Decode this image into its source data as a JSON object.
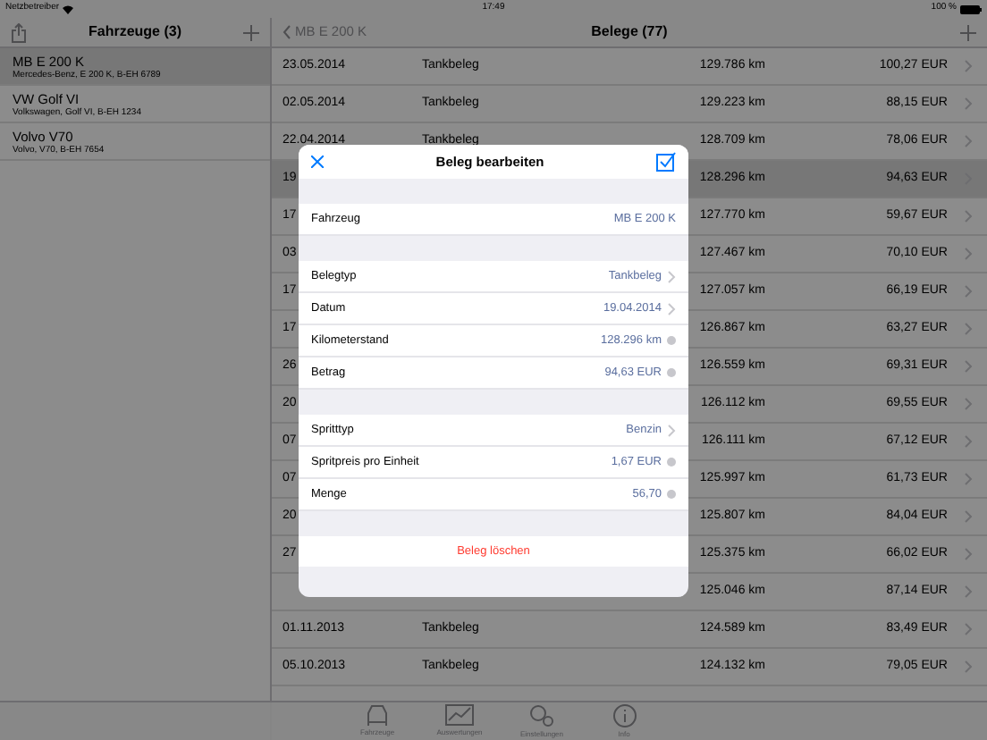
{
  "status_bar": {
    "carrier": "Netzbetreiber",
    "time": "17:49",
    "battery": "100 %"
  },
  "sidebar": {
    "title": "Fahrzeuge (3)",
    "items": [
      {
        "name": "MB E 200 K",
        "detail": "Mercedes-Benz, E 200 K, B-EH 6789",
        "selected": true
      },
      {
        "name": "VW Golf VI",
        "detail": "Volkswagen, Golf VI, B-EH 1234",
        "selected": false
      },
      {
        "name": "Volvo V70",
        "detail": "Volvo, V70, B-EH 7654",
        "selected": false
      }
    ]
  },
  "detail": {
    "back": "MB E 200 K",
    "title": "Belege (77)",
    "rows": [
      {
        "date": "23.05.2014",
        "type": "Tankbeleg",
        "km": "129.786 km",
        "amount": "100,27 EUR",
        "selected": false
      },
      {
        "date": "02.05.2014",
        "type": "Tankbeleg",
        "km": "129.223 km",
        "amount": "88,15 EUR",
        "selected": false
      },
      {
        "date": "22.04.2014",
        "type": "Tankbeleg",
        "km": "128.709 km",
        "amount": "78,06 EUR",
        "selected": false
      },
      {
        "date": "19",
        "km": "128.296 km",
        "amount": "94,63 EUR",
        "selected": true
      },
      {
        "date": "17",
        "km": "127.770 km",
        "amount": "59,67 EUR",
        "selected": false
      },
      {
        "date": "03",
        "km": "127.467 km",
        "amount": "70,10 EUR",
        "selected": false
      },
      {
        "date": "17",
        "km": "127.057 km",
        "amount": "66,19 EUR",
        "selected": false
      },
      {
        "date": "17",
        "km": "126.867 km",
        "amount": "63,27 EUR",
        "selected": false
      },
      {
        "date": "26",
        "km": "126.559 km",
        "amount": "69,31 EUR",
        "selected": false
      },
      {
        "date": "20",
        "km": "126.112 km",
        "amount": "69,55 EUR",
        "selected": false
      },
      {
        "date": "07",
        "km": "126.111 km",
        "amount": "67,12 EUR",
        "selected": false
      },
      {
        "date": "07",
        "km": "125.997 km",
        "amount": "61,73 EUR",
        "selected": false
      },
      {
        "date": "20",
        "km": "125.807 km",
        "amount": "84,04 EUR",
        "selected": false
      },
      {
        "date": "27",
        "km": "125.375 km",
        "amount": "66,02 EUR",
        "selected": false
      },
      {
        "km": "125.046 km",
        "amount": "87,14 EUR",
        "selected": false
      },
      {
        "date": "01.11.2013",
        "type": "Tankbeleg",
        "km": "124.589 km",
        "amount": "83,49 EUR",
        "selected": false
      },
      {
        "date": "05.10.2013",
        "type": "Tankbeleg",
        "km": "124.132 km",
        "amount": "79,05 EUR",
        "selected": false
      }
    ]
  },
  "tab_bar": [
    {
      "label": "Fahrzeuge",
      "kind": "car"
    },
    {
      "label": "Auswertungen",
      "kind": "chart"
    },
    {
      "label": "Einstellungen",
      "kind": "gears"
    },
    {
      "label": "Info",
      "kind": "info"
    }
  ],
  "dialog": {
    "title": "Beleg bearbeiten",
    "sections": [
      [
        {
          "label": "Fahrzeug",
          "value": "MB E 200 K",
          "kind": "static"
        }
      ],
      [
        {
          "label": "Belegtyp",
          "value": "Tankbeleg",
          "kind": "link"
        },
        {
          "label": "Datum",
          "value": "19.04.2014",
          "kind": "link"
        },
        {
          "label": "Kilometerstand",
          "value": "128.296 km",
          "kind": "input"
        },
        {
          "label": "Betrag",
          "value": "94,63 EUR",
          "kind": "input"
        }
      ],
      [
        {
          "label": "Spritttyp",
          "value": "Benzin",
          "kind": "link"
        },
        {
          "label": "Spritpreis pro Einheit",
          "value": "1,67 EUR",
          "kind": "input"
        },
        {
          "label": "Menge",
          "value": "56,70",
          "kind": "input"
        }
      ]
    ],
    "delete": "Beleg löschen"
  }
}
